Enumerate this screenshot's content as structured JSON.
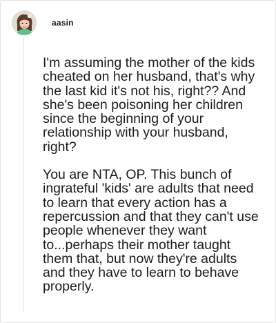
{
  "comment": {
    "author": "aasin",
    "avatar_icon": "user-avatar",
    "paragraphs": [
      "I'm assuming the mother of the kids cheated on her husband, that's why the last kid it's not his, right?? And she's been poisoning her children since the beginning of your relationship with your husband, right?",
      "You are NTA, OP. This bunch of ingrateful 'kids' are adults that need to learn that every action has a repercussion and that they can't use people whenever they want to...perhaps their mother taught them that, but now they're adults and they have to learn to behave properly."
    ]
  }
}
